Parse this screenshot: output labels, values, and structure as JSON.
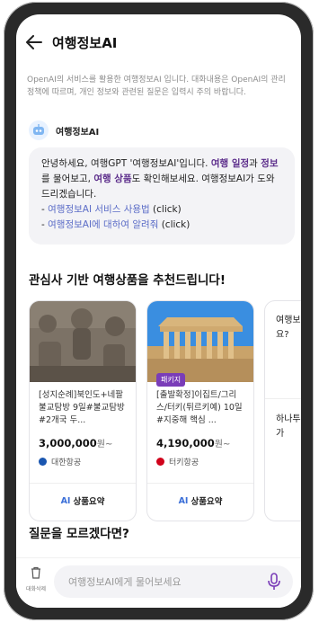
{
  "header": {
    "title": "여행정보AI"
  },
  "notice": "OpenAI의 서비스를 활용한 여행정보AI 입니다. 대화내용은 OpenAI의 관리 정책에 따르며, 개인 정보와 관련된 질문은 입력시 주의 바랍니다.",
  "bot": {
    "name": "여행정보AI"
  },
  "message": {
    "p1": "안녕하세요, 여행GPT '여행정보AI'입니다. ",
    "h1": "여행 일정",
    "p2": "과 ",
    "h2": "정보",
    "p3": "를 물어보고, ",
    "h3": "여행 상품",
    "p4": "도 확인해보세요. 여행정보AI가 도와드리겠습니다.",
    "l1_prefix": "- ",
    "l1_link": "여행정보AI 서비스 사용법",
    "l1_suffix": " (click)",
    "l2_prefix": "- ",
    "l2_link": "여행정보AI에 대하여 알려줘",
    "l2_suffix": " (click)"
  },
  "products": {
    "title": "관심사 기반 여행상품을 추천드립니다!",
    "items": [
      {
        "title": "[성지순례]북인도+네팔 불교탐방 9일#불교탐방 #2개국 두...",
        "price": "3,000,000",
        "unit": "원~",
        "airline": "대한항공",
        "airline_color": "#1a56b0",
        "button_ai": "AI",
        "button": "상품요약",
        "badge": ""
      },
      {
        "title": "[출발확정]이집트/그리스/터키(튀르키예) 10일#지중해 핵심 ...",
        "price": "4,190,000",
        "unit": "원~",
        "airline": "터키항공",
        "airline_color": "#d0021b",
        "button_ai": "AI",
        "button": "상품요약",
        "badge": "패키지"
      }
    ],
    "partial": {
      "question": "여행보 무엇을 요?",
      "answer": "하나투 친 추가"
    }
  },
  "faq": {
    "title": "질문을 모르겠다면?"
  },
  "input": {
    "placeholder": "여행정보AI에게 물어보세요",
    "trash_label": "대화삭제"
  }
}
